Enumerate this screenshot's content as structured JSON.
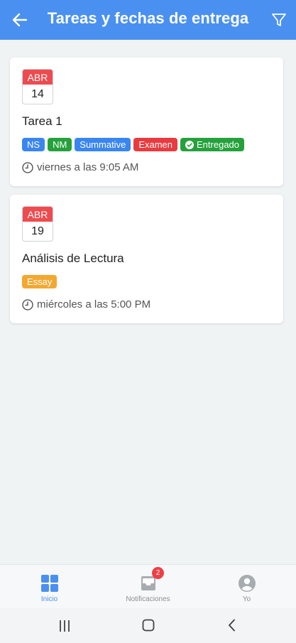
{
  "header": {
    "title": "Tareas y fechas de entrega",
    "back_icon": "arrow-left-icon",
    "filter_icon": "filter-icon"
  },
  "assignments": [
    {
      "month": "ABR",
      "day": "14",
      "title": "Tarea 1",
      "tags": [
        {
          "label": "NS",
          "color": "#3a86f0"
        },
        {
          "label": "NM",
          "color": "#25a13c"
        },
        {
          "label": "Summative",
          "color": "#3a86f0"
        },
        {
          "label": "Examen",
          "color": "#ea3a3f"
        },
        {
          "label": "Entregado",
          "color": "#25a13c",
          "icon": "check-circle-icon"
        }
      ],
      "due": "viernes a las 9:05 AM"
    },
    {
      "month": "ABR",
      "day": "19",
      "title": "Análisis de Lectura",
      "tags": [
        {
          "label": "Essay",
          "color": "#f3a830"
        }
      ],
      "due": "miércoles a las 5:00 PM"
    }
  ],
  "bottom_nav": {
    "items": [
      {
        "label": "Inicio",
        "icon": "grid-icon",
        "active": true
      },
      {
        "label": "Notificaciones",
        "icon": "inbox-icon",
        "badge": "2"
      },
      {
        "label": "Yo",
        "icon": "profile-icon"
      }
    ]
  },
  "colors": {
    "primary": "#4a90f0",
    "calendar_red": "#ee4b4f"
  }
}
